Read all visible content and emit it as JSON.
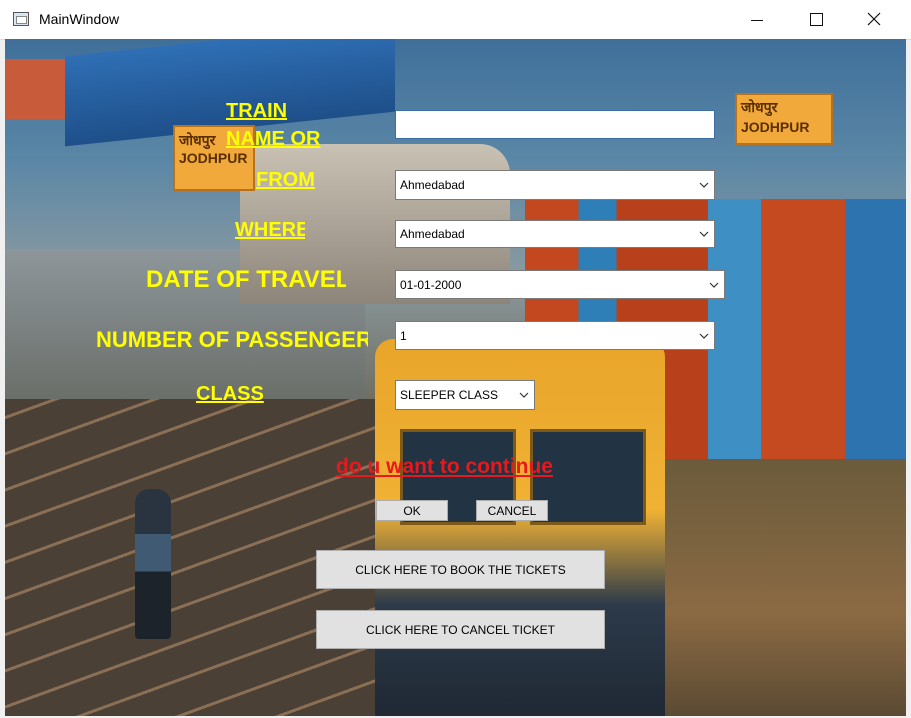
{
  "window": {
    "title": "MainWindow",
    "controls": {
      "minimize": "minimize-icon",
      "maximize": "maximize-icon",
      "close": "close-icon"
    }
  },
  "background": {
    "signs": {
      "left": "जोधपुर JODHPUR",
      "right": "जोधपुर JODHPUR"
    }
  },
  "form": {
    "labels": {
      "train": "TRAIN",
      "name_or": "NAME OR",
      "from": "FROM",
      "where": "WHERE",
      "date": "DATE OF TRAVEL",
      "passengers": "NUMBER OF PASSENGERS",
      "class": "CLASS"
    },
    "train_input": {
      "value": "",
      "placeholder": ""
    },
    "from_select": {
      "value": "Ahmedabad"
    },
    "where_select": {
      "value": "Ahmedabad"
    },
    "date_select": {
      "value": "01-01-2000"
    },
    "passengers_select": {
      "value": "1"
    },
    "class_select": {
      "value": "SLEEPER CLASS"
    }
  },
  "confirm": {
    "prompt": "do u want to continue",
    "ok_label": "OK",
    "cancel_label": "CANCEL"
  },
  "actions": {
    "book_label": "CLICK HERE TO BOOK THE TICKETS",
    "cancel_ticket_label": "CLICK HERE TO CANCEL TICKET"
  },
  "colors": {
    "label_yellow": "#ffff00",
    "prompt_red": "#e8191c",
    "button_face": "#e1e1e1"
  }
}
